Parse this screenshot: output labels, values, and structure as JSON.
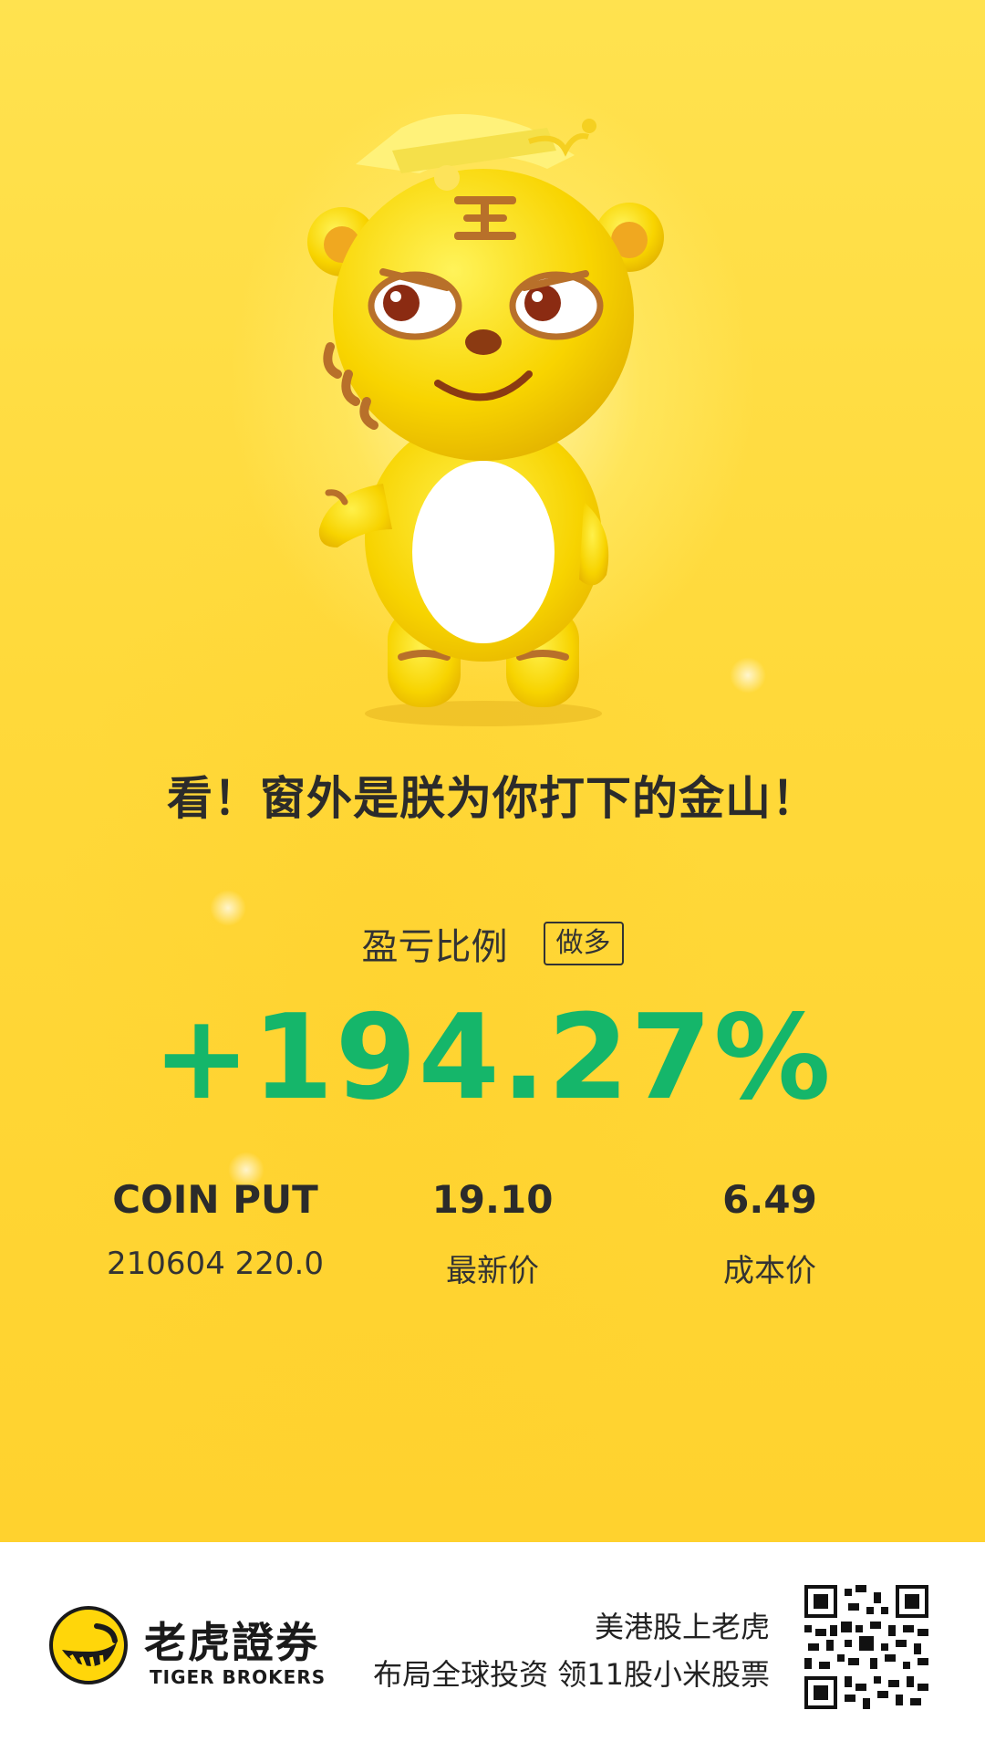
{
  "poster": {
    "headline": "看！窗外是朕为你打下的金山！",
    "ratio_label": "盈亏比例",
    "direction": "做多",
    "pnl_percent": "+194.27%",
    "instrument": {
      "name": "COIN PUT",
      "contract": "210604 220.0"
    },
    "latest_price": {
      "value": "19.10",
      "label": "最新价"
    },
    "cost_price": {
      "value": "6.49",
      "label": "成本价"
    }
  },
  "footer": {
    "brand_cn": "老虎證券",
    "brand_en": "TIGER BROKERS",
    "slogan_line1": "美港股上老虎",
    "slogan_line2": "布局全球投资 领11股小米股票"
  },
  "colors": {
    "background": "#ffd935",
    "gain": "#15b66a",
    "text": "#2b2b2b"
  },
  "icons": [
    "tiger-mascot",
    "tiger-brokers-logo",
    "qr-code"
  ]
}
